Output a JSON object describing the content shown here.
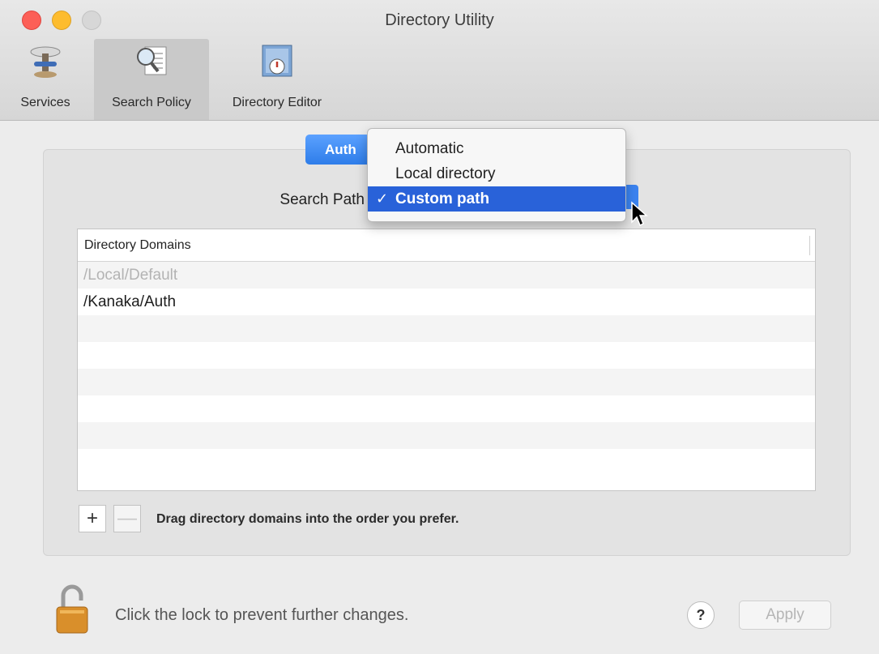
{
  "window": {
    "title": "Directory Utility",
    "traffic_lights": [
      "close",
      "minimize",
      "zoom"
    ]
  },
  "toolbar": {
    "items": [
      {
        "label": "Services",
        "icon": "services-icon",
        "selected": false
      },
      {
        "label": "Search Policy",
        "icon": "search-policy-icon",
        "selected": true
      },
      {
        "label": "Directory Editor",
        "icon": "directory-editor-icon",
        "selected": false
      }
    ]
  },
  "segment": {
    "label": "Auth"
  },
  "search_path": {
    "label": "Search Path",
    "menu_options": [
      "Automatic",
      "Local directory",
      "Custom path"
    ],
    "selected_option": "Custom path",
    "check": "✓"
  },
  "table": {
    "header": "Directory Domains",
    "rows": [
      {
        "value": "/Local/Default",
        "dim": true
      },
      {
        "value": "/Kanaka/Auth",
        "dim": false
      }
    ]
  },
  "controls": {
    "add": "+",
    "remove": "—",
    "hint": "Drag directory domains into the order you prefer."
  },
  "footer": {
    "lock_text": "Click the lock to prevent further changes.",
    "help": "?",
    "apply": "Apply"
  },
  "colors": {
    "accent": "#2962d9",
    "segment": "#3b83f0"
  }
}
